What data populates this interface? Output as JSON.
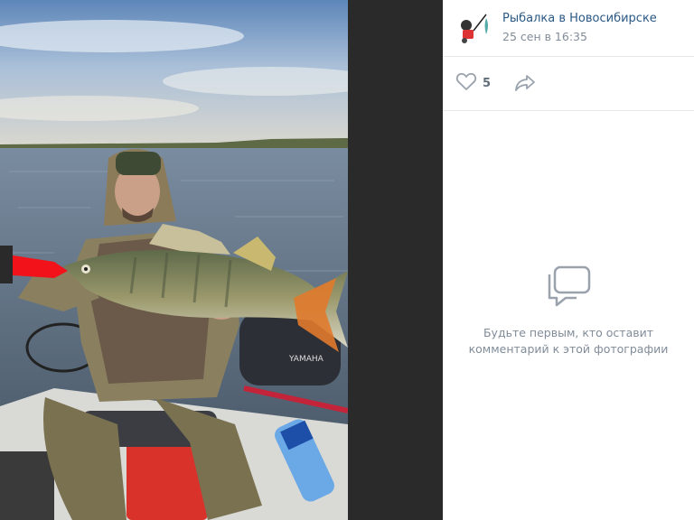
{
  "photo": {
    "alt": "Фото: рыбак с судаком в лодке",
    "boat_brand": "YAMAHA"
  },
  "author": {
    "name": "Рыбалка в Новосибирске",
    "date": "25 сен в 16:35"
  },
  "actions": {
    "like_count": "5",
    "like_icon": "heart-icon",
    "share_icon": "share-arrow-icon"
  },
  "comments": {
    "empty_icon": "comments-icon",
    "empty_text": "Будьте первым, кто оставит комментарий к этой фотографии"
  },
  "colors": {
    "link": "#2a5885",
    "muted": "#818c99",
    "icon": "#99a2ad",
    "divider": "#e7e8ec",
    "backdrop": "#2a2a2a"
  }
}
